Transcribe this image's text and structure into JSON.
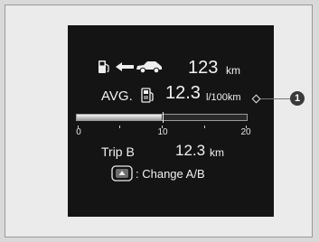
{
  "range": {
    "value": "123",
    "unit": "km",
    "icons": [
      "fuel-pump-icon",
      "arrow-left-icon",
      "car-icon"
    ]
  },
  "avg": {
    "label": "AVG.",
    "value": "12.3",
    "unit": "l/100km",
    "icon": "fuel-economy-icon"
  },
  "gauge": {
    "ticks": [
      "0",
      "10",
      "20"
    ],
    "fill_fraction": 0.5
  },
  "trip": {
    "label": "Trip B",
    "value": "12.3",
    "unit": "km"
  },
  "footer": {
    "icon": "steering-switch-icon",
    "label": ": Change A/B"
  },
  "callout": {
    "number": "1"
  },
  "colors": {
    "screen": "#141414",
    "text": "#f2f2f2",
    "page": "#ebebeb"
  }
}
